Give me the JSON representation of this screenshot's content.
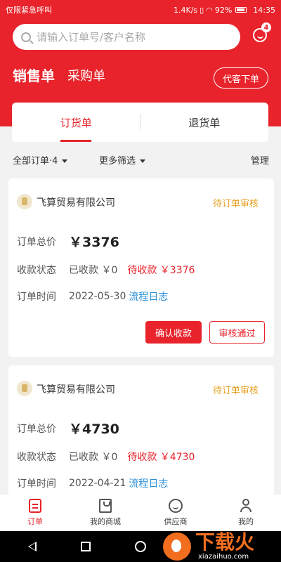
{
  "statusbar": {
    "carrier": "仅限紧急呼叫",
    "speed": "1.4K/s",
    "battery": "92%",
    "time": "14:35"
  },
  "search": {
    "placeholder": "请输入订单号/客户名称"
  },
  "messages": {
    "badge": "4"
  },
  "header": {
    "tab_sales": "销售单",
    "tab_purchase": "采购单",
    "proxy_order": "代客下单"
  },
  "subtabs": {
    "order": "订货单",
    "return": "退货单"
  },
  "filters": {
    "all_orders": "全部订单·4",
    "more_filters": "更多筛选",
    "manage": "管理"
  },
  "labels": {
    "total": "订单总价",
    "payment_status": "收款状态",
    "order_time": "订单时间",
    "process_log": "流程日志",
    "confirm_payment": "确认收款",
    "approve": "审核通过"
  },
  "orders": [
    {
      "company": "飞算贸易有限公司",
      "status": "待订单审核",
      "total": "￥3376",
      "paid": "已收款 ￥0",
      "unpaid": "待收款 ￥3376",
      "date": "2022-05-30"
    },
    {
      "company": "飞算贸易有限公司",
      "status": "待订单审核",
      "total": "￥4730",
      "paid": "已收款 ￥0",
      "unpaid": "待收款 ￥4730",
      "date": "2022-04-21"
    }
  ],
  "bottomnav": {
    "orders": "订单",
    "my_shop": "我的商城",
    "supplier": "供应商",
    "mine": "我的"
  },
  "watermark": {
    "brand": "下载火",
    "url": "xiazaihuo.com"
  },
  "colors": {
    "primary": "#e8232b",
    "pending": "#e6a020",
    "link": "#2a8fd8"
  }
}
